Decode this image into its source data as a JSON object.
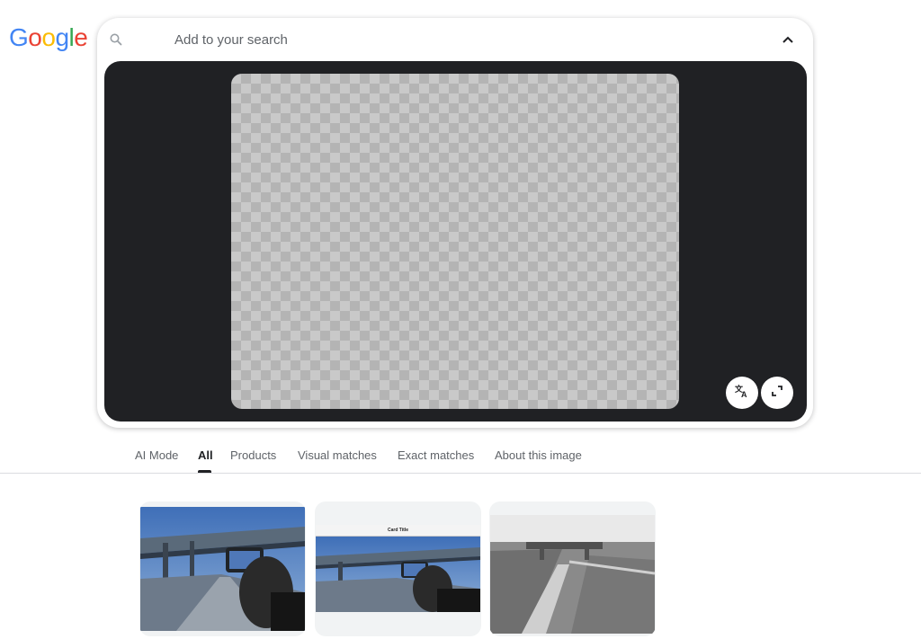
{
  "logo": {
    "letters": [
      "G",
      "o",
      "o",
      "g",
      "l",
      "e"
    ],
    "colors": [
      "#4285F4",
      "#EA4335",
      "#FBBC05",
      "#4285F4",
      "#34A853",
      "#EA4335"
    ]
  },
  "search": {
    "placeholder": "Add to your search",
    "icon": "search-icon"
  },
  "viewer": {
    "buttons": [
      {
        "name": "translate-icon"
      },
      {
        "name": "expand-icon"
      }
    ]
  },
  "tabs": [
    {
      "label": "AI Mode",
      "active": false
    },
    {
      "label": "All",
      "active": true
    },
    {
      "label": "Products",
      "active": false
    },
    {
      "label": "Visual matches",
      "active": false
    },
    {
      "label": "Exact matches",
      "active": false
    },
    {
      "label": "About this image",
      "active": false
    }
  ],
  "results": [
    {
      "kind": "photo-overpass-phone"
    },
    {
      "kind": "card-screenshot",
      "caption": "Card Title"
    },
    {
      "kind": "photo-overpass-bw"
    }
  ]
}
